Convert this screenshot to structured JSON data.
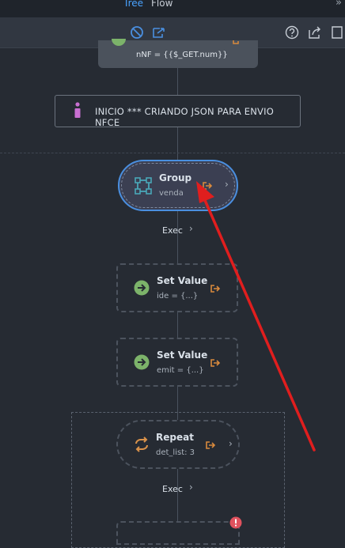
{
  "tabs": [
    {
      "label": "Tree",
      "active": true
    },
    {
      "label": "Flow",
      "active": false
    }
  ],
  "toolbar": {
    "icons": [
      "disable-icon",
      "export-flow-icon",
      "help-icon",
      "share-icon",
      "expand-icon"
    ]
  },
  "nodes": {
    "previous": {
      "sub": "nNF = {{$_GET.num}}"
    },
    "info": {
      "text": "INICIO *** CRIANDO JSON PARA ENVIO NFCE"
    },
    "group": {
      "title": "Group",
      "sub": "venda"
    },
    "exec1": {
      "label": "Exec"
    },
    "set_value_1": {
      "title": "Set Value",
      "sub": "ide = {...}"
    },
    "set_value_2": {
      "title": "Set Value",
      "sub": "emit = {...}"
    },
    "repeat": {
      "title": "Repeat",
      "sub": "det_list: 3"
    },
    "exec2": {
      "label": "Exec"
    }
  },
  "colors": {
    "accent": "#4a8fe0",
    "tab_active": "#4aa3ff",
    "set_value_icon": "#7cb36a",
    "repeat_icon": "#d9924a",
    "info_icon": "#c86fd1",
    "output_icon": "#d98a3d",
    "error_badge": "#e0525e",
    "annotation_arrow": "#e01e1e"
  }
}
